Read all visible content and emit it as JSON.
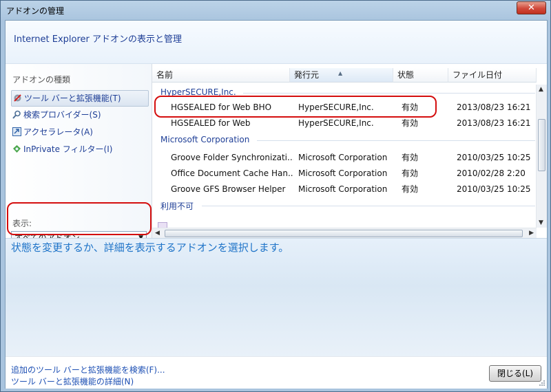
{
  "window": {
    "title": "アドオンの管理"
  },
  "header": {
    "title": "Internet Explorer アドオンの表示と管理"
  },
  "sidebar": {
    "section_label": "アドオンの種類",
    "items": [
      {
        "label": "ツール バーと拡張機能(T)",
        "icon": "gear-icon"
      },
      {
        "label": "検索プロバイダー(S)",
        "icon": "search-icon"
      },
      {
        "label": "アクセラレータ(A)",
        "icon": "accelerator-icon"
      },
      {
        "label": "InPrivate フィルター(I)",
        "icon": "inprivate-icon"
      }
    ],
    "show_label": "表示:",
    "show_value": "すべてのアドオン"
  },
  "list": {
    "columns": [
      "名前",
      "発行元",
      "状態",
      "ファイル日付"
    ],
    "groups": [
      {
        "name": "HyperSECURE,Inc.",
        "rows": [
          {
            "name": "HGSEALED for Web BHO",
            "publisher": "HyperSECURE,Inc.",
            "status": "有効",
            "date": "2013/08/23 16:21"
          },
          {
            "name": "HGSEALED for Web",
            "publisher": "HyperSECURE,Inc.",
            "status": "有効",
            "date": "2013/08/23 16:21"
          }
        ]
      },
      {
        "name": "Microsoft Corporation",
        "rows": [
          {
            "name": "Groove Folder Synchronizati...",
            "publisher": "Microsoft Corporation",
            "status": "有効",
            "date": "2010/03/25 10:25"
          },
          {
            "name": "Office Document Cache Han...",
            "publisher": "Microsoft Corporation",
            "status": "有効",
            "date": "2010/02/28 2:20"
          },
          {
            "name": "Groove GFS Browser Helper",
            "publisher": "Microsoft Corporation",
            "status": "有効",
            "date": "2010/03/25 10:25"
          }
        ]
      },
      {
        "name": "利用不可",
        "rows": []
      }
    ]
  },
  "details": {
    "message": "状態を変更するか、詳細を表示するアドオンを選択します。"
  },
  "footer": {
    "links": [
      "追加のツール バーと拡張機能を検索(F)...",
      "ツール バーと拡張機能の詳細(N)"
    ],
    "close_button": "閉じる(L)"
  },
  "colors": {
    "highlight_ring": "#d40d0d",
    "link": "#1e50b4",
    "group_header": "#1e3e96"
  }
}
